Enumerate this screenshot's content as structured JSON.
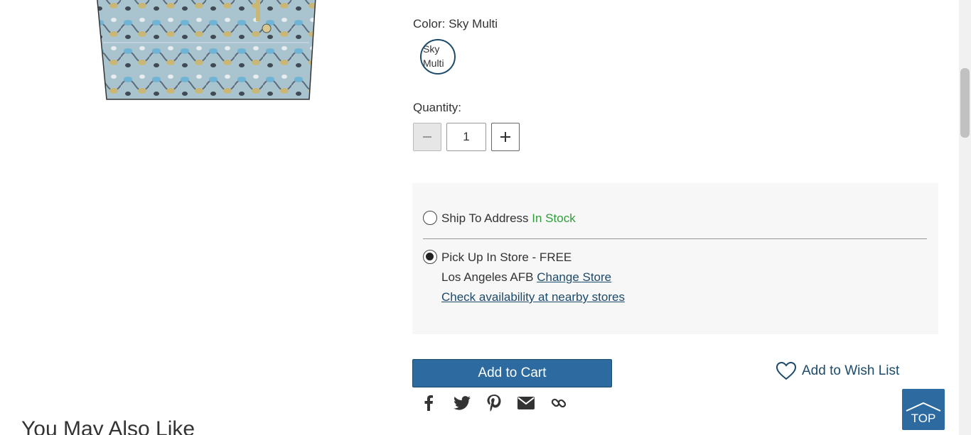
{
  "product": {
    "image_alt": "Snakeskin tote bag in sky multi"
  },
  "color": {
    "label": "Color:",
    "value": "Sky Multi",
    "swatch_alt": "Sky Multi"
  },
  "quantity": {
    "label": "Quantity:",
    "value": "1"
  },
  "fulfillment": {
    "ship_label": "Ship To Address",
    "ship_status": "In Stock",
    "pickup_label": "Pick Up In Store - FREE",
    "store_name": "Los Angeles AFB",
    "change_store": "Change Store",
    "nearby_link": "Check availability at nearby stores",
    "selected": "pickup"
  },
  "actions": {
    "add_to_cart": "Add to Cart",
    "wishlist": "Add to Wish List"
  },
  "share": [
    "facebook-icon",
    "twitter-icon",
    "pinterest-icon",
    "email-icon",
    "link-icon"
  ],
  "recommendations": {
    "heading": "You May Also Like"
  },
  "top_button": {
    "label": "TOP"
  },
  "colors": {
    "brand": "#2c6aa0",
    "link": "#1c4a6b",
    "in_stock": "#2e9e3a",
    "panel": "#f7f7f7"
  }
}
